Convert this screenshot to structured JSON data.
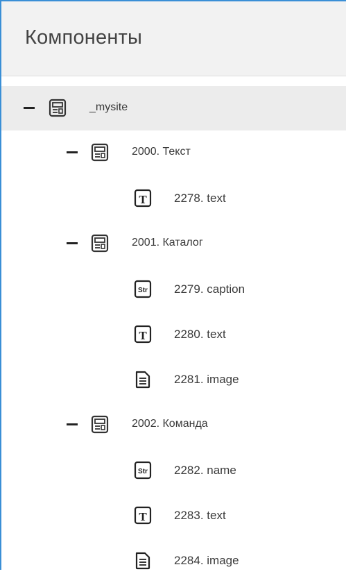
{
  "header": {
    "title": "Компоненты"
  },
  "tree": {
    "root": {
      "label": "_mysite",
      "icon": "template-icon",
      "expanded": true
    },
    "groups": [
      {
        "label": "2000. Текст",
        "icon": "template-icon",
        "expanded": true,
        "children": [
          {
            "label": "2278. text",
            "icon": "text-T-icon"
          }
        ]
      },
      {
        "label": "2001. Каталог",
        "icon": "template-icon",
        "expanded": true,
        "children": [
          {
            "label": "2279. caption",
            "icon": "string-Str-icon"
          },
          {
            "label": "2280. text",
            "icon": "text-T-icon"
          },
          {
            "label": "2281. image",
            "icon": "document-icon"
          }
        ]
      },
      {
        "label": "2002. Команда",
        "icon": "template-icon",
        "expanded": true,
        "children": [
          {
            "label": "2282. name",
            "icon": "string-Str-icon"
          },
          {
            "label": "2283. text",
            "icon": "text-T-icon"
          },
          {
            "label": "2284. image",
            "icon": "document-icon"
          }
        ]
      }
    ]
  },
  "colors": {
    "border_accent": "#3a8fd6",
    "header_bg": "#f2f2f2",
    "selected_bg": "#ececec"
  }
}
